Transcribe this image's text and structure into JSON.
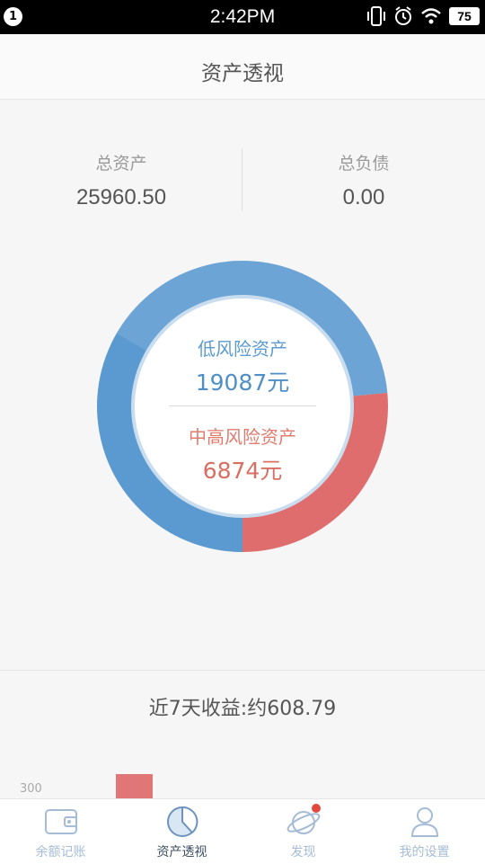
{
  "status_bar": {
    "notification_count": "1",
    "time": "2:42PM",
    "battery": "75",
    "icons": [
      "vibrate-icon",
      "alarm-icon",
      "wifi-icon",
      "battery-icon"
    ]
  },
  "header": {
    "title": "资产透视"
  },
  "summary": {
    "total_assets_label": "总资产",
    "total_assets_value": "25960.50",
    "total_liabilities_label": "总负债",
    "total_liabilities_value": "0.00"
  },
  "donut": {
    "low_risk_label": "低风险资产",
    "low_risk_value": "19087元",
    "high_risk_label": "中高风险资产",
    "high_risk_value": "6874元",
    "low_risk_amount": 19087,
    "high_risk_amount": 6874,
    "colors": {
      "low": "#5b9ad0",
      "high": "#e06d6d",
      "low_light": "#8ab8e0"
    }
  },
  "earnings": {
    "text": "近7天收益:约608.79",
    "axis_tick": "300"
  },
  "tabbar": {
    "tabs": [
      {
        "label": "余额记账",
        "icon": "wallet-icon",
        "active": false
      },
      {
        "label": "资产透视",
        "icon": "pie-chart-icon",
        "active": true
      },
      {
        "label": "发现",
        "icon": "planet-icon",
        "active": false,
        "badge": true
      },
      {
        "label": "我的设置",
        "icon": "user-icon",
        "active": false
      }
    ]
  }
}
